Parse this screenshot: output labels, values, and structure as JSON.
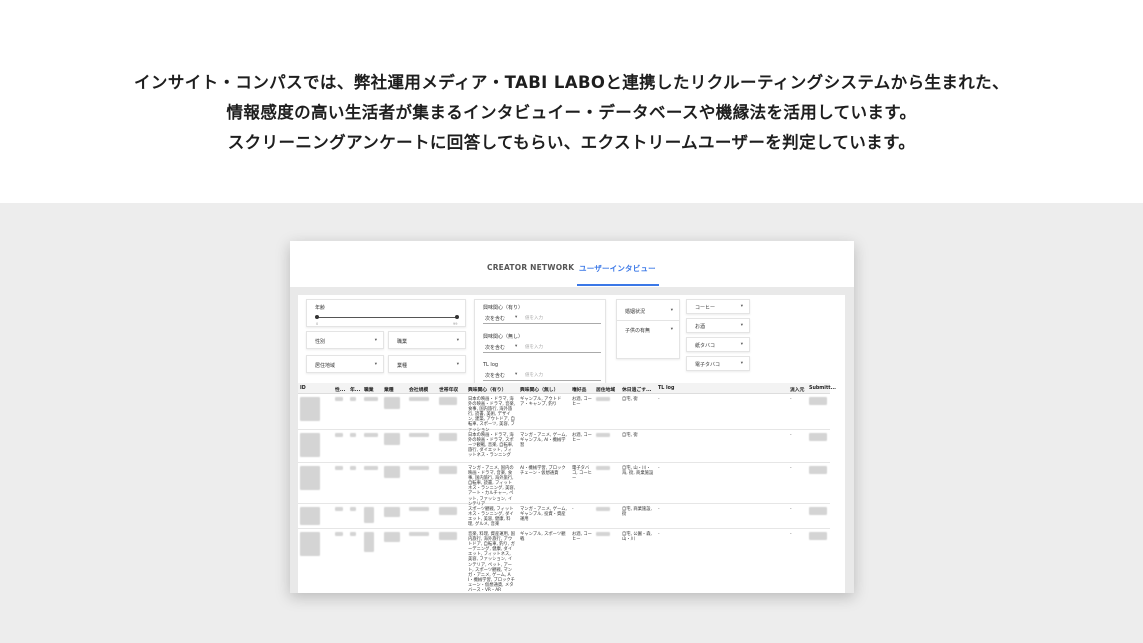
{
  "intro": {
    "line1": "インサイト・コンパスでは、弊社運用メディア・TABI LABOと連携したリクルーティングシステムから生まれた、",
    "line2": "情報感度の高い生活者が集まるインタビュイー・データベースや機縁法を活用しています。",
    "line3": "スクリーニングアンケートに回答してもらい、エクストリームユーザーを判定しています。"
  },
  "tabs": [
    {
      "label": "CREATOR NETWORK",
      "active": false
    },
    {
      "label": "ユーザーインタビュー",
      "active": true
    }
  ],
  "accent_color": "#3b78e7",
  "filters": {
    "age_label": "年齢",
    "age_min": "0",
    "age_max": "99",
    "gender": "性別",
    "occupation": "職業",
    "residence": "居住地域",
    "industry": "業種",
    "interest_yes_label": "興味関心（有り）",
    "interest_no_label": "興味関心（無し）",
    "tl_log_label": "TL log",
    "mode_option": "次を含む",
    "input_placeholder": "値を入力",
    "marital": "婚姻状況",
    "children": "子供の有無",
    "coffee": "コーヒー",
    "alcohol": "お酒",
    "cigarette": "紙タバコ",
    "ecig": "電子タバコ"
  },
  "table": {
    "headers": [
      "ID",
      "性...",
      "年...",
      "職業",
      "業種",
      "会社規模",
      "世帯年収",
      "興味関心（有り）",
      "興味関心（無し）",
      "嗜好品",
      "居住地域",
      "休日過ごす...",
      "TL log",
      "流入元",
      "Submitt..."
    ],
    "rows": [
      {
        "interest_yes": "日本の映画・ドラマ, 海外の映画・ドラマ, 音楽, 食事, 国内旅行, 海外旅行, 読書, 美術, デザイン, 建築, アウトドア, 自転車, スポーツ, 美容, ファッション",
        "interest_no": "ギャンブル, アウトドア・キャンプ, 釣り",
        "preference": "お酒, コーヒー",
        "holiday": "自宅, 街",
        "tl": "-",
        "source": "-"
      },
      {
        "interest_yes": "日本の映画・ドラマ, 海外の映画・ドラマ, スポーツ観戦, 音楽, 自転車, 旅行, ダイエット, フィットネス・ランニング",
        "interest_no": "マンガ・アニメ, ゲーム, ギャンブル, AI・機械学習",
        "preference": "お酒, コーヒー",
        "holiday": "自宅, 街",
        "tl": "",
        "source": "-"
      },
      {
        "interest_yes": "マンガ・アニメ, 国内の映画・ドラマ, 音楽, 食事, 国内旅行, 海外旅行, 自転車, 読書, フィットネス・ランニング, 美容, アート・カルチャー, ペット, ファッション, インテリア",
        "interest_no": "AI・機械学習, ブロックチェーン・仮想通貨",
        "preference": "電子タバコ, コーヒー",
        "holiday": "自宅, 山・川・海, 街, 商業施設",
        "tl": "-",
        "source": "-"
      },
      {
        "interest_yes": "スポーツ観戦, フィットネス・ランニング, ダイエット, 美容, 健康, 料理, グルメ, 音楽",
        "interest_no": "マンガ・アニメ, ゲーム, ギャンブル, 投資・資産運用",
        "preference": "-",
        "holiday": "自宅, 商業施設, 街",
        "tl": "-",
        "source": "-"
      },
      {
        "interest_yes": "音楽, 料理, 資産運用, 国内旅行, 海外旅行, アウトドア, 自転車, 釣り, ガーデニング, 健康, ダイエット, フィットネス, 美容, ファッション, インテリア, ペット, アート, スポーツ観戦, マンガ・アニメ, ゲーム, AI・機械学習, ブロックチェーン・仮想通貨, メタバース・VR・AR",
        "interest_no": "ギャンブル, スポーツ観戦",
        "preference": "お酒, コーヒー",
        "holiday": "自宅, 公園・森, 山・川",
        "tl": "-",
        "source": "-"
      }
    ]
  }
}
